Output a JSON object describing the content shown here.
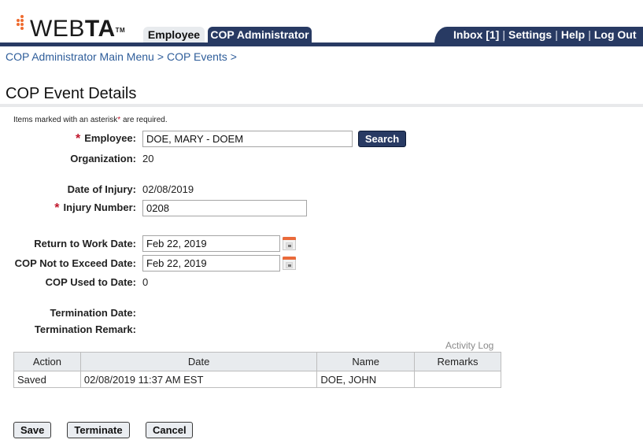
{
  "app": {
    "logo_light": "WEB",
    "logo_bold": "TA",
    "logo_trademark": "TM",
    "brand_color": "#283a63",
    "accent_color": "#ef6b2f"
  },
  "tabs": [
    {
      "label": "Employee",
      "active": false
    },
    {
      "label": "COP Administrator",
      "active": true
    }
  ],
  "util_nav": {
    "inbox": "Inbox [1]",
    "settings": "Settings",
    "help": "Help",
    "logout": "Log Out",
    "separator": "|"
  },
  "breadcrumb": {
    "items": [
      "COP Administrator Main Menu",
      "COP Events"
    ],
    "separator": ">"
  },
  "page": {
    "title": "COP Event Details",
    "required_note_pre": "Items marked with an asterisk",
    "required_note_ast": "*",
    "required_note_post": " are required."
  },
  "form": {
    "required_marker": "*",
    "employee": {
      "label": "Employee:",
      "value": "DOE, MARY - DOEM",
      "search_label": "Search"
    },
    "organization": {
      "label": "Organization:",
      "value": "20"
    },
    "date_of_injury": {
      "label": "Date of Injury:",
      "value": "02/08/2019"
    },
    "injury_number": {
      "label": "Injury Number:",
      "value": "0208"
    },
    "return_to_work": {
      "label": "Return to Work Date:",
      "value": "Feb 22, 2019"
    },
    "not_to_exceed": {
      "label": "COP Not to Exceed Date:",
      "value": "Feb 22, 2019"
    },
    "cop_used": {
      "label": "COP Used to Date:",
      "value": "0"
    },
    "termination_date": {
      "label": "Termination Date:",
      "value": ""
    },
    "termination_remark": {
      "label": "Termination Remark:",
      "value": ""
    }
  },
  "activity_log": {
    "caption": "Activity Log",
    "columns": [
      "Action",
      "Date",
      "Name",
      "Remarks"
    ],
    "rows": [
      {
        "action": "Saved",
        "date": "02/08/2019 11:37 AM EST",
        "name": "DOE, JOHN",
        "remarks": ""
      }
    ]
  },
  "buttons": {
    "save": "Save",
    "terminate": "Terminate",
    "cancel": "Cancel"
  }
}
